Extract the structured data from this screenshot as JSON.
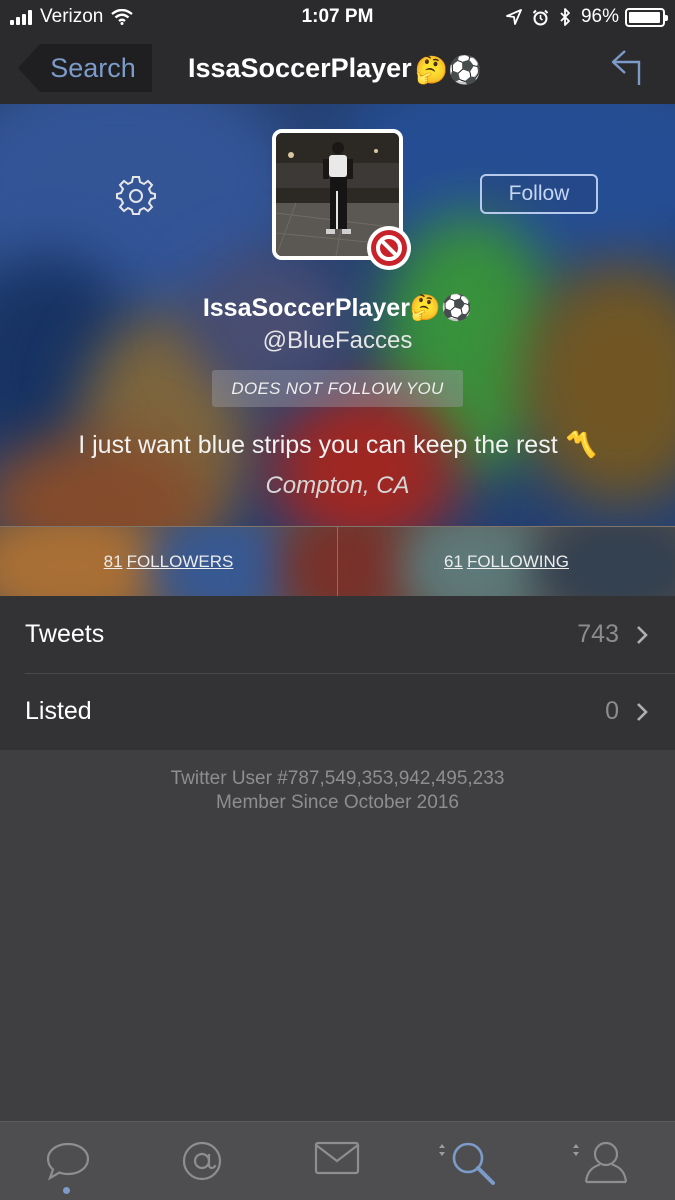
{
  "status_bar": {
    "carrier": "Verizon",
    "time": "1:07 PM",
    "battery": "96%",
    "battery_level": 0.96
  },
  "nav": {
    "back_label": "Search",
    "title": "IssaSoccerPlayer",
    "title_emojis": "🤔⚽"
  },
  "profile": {
    "display_name": "IssaSoccerPlayer",
    "name_emojis": "🤔⚽",
    "handle": "@BlueFacces",
    "follow_button": "Follow",
    "follow_status": "DOES NOT FOLLOW YOU",
    "bio": "I just want blue strips you can keep the rest",
    "bio_emoji": "〽️",
    "location": "Compton, CA"
  },
  "counts": {
    "followers_num": "81",
    "followers_label": "FOLLOWERS",
    "following_num": "61",
    "following_label": "FOLLOWING"
  },
  "stats": [
    {
      "label": "Tweets",
      "value": "743"
    },
    {
      "label": "Listed",
      "value": "0"
    }
  ],
  "meta": {
    "user_id": "Twitter User #787,549,353,942,495,233",
    "member_since": "Member Since October 2016"
  },
  "tabs": [
    "timeline-icon",
    "mentions-icon",
    "messages-icon",
    "search-icon",
    "profile-icon"
  ],
  "colors": {
    "accent": "#7c9bc9",
    "background": "#3f3f41",
    "bar": "#2b2b2d",
    "blocked": "#c8232a"
  }
}
